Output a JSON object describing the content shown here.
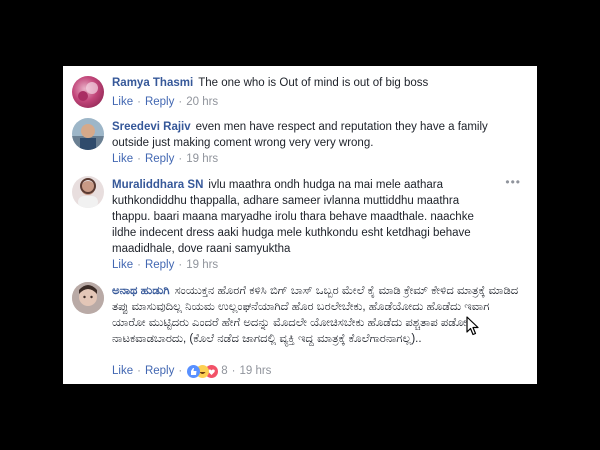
{
  "colors": {
    "name": "#365899",
    "link": "#4267b2",
    "meta": "#90949c",
    "text": "#1d2129"
  },
  "actions": {
    "like": "Like",
    "reply": "Reply",
    "sep": "·"
  },
  "comments": [
    {
      "name": "Ramya Thasmi",
      "text": "The one who is Out of mind is out of big boss",
      "time": "20 hrs"
    },
    {
      "name": "Sreedevi Rajiv",
      "text": "even men have respect and reputation they have a family outside just making coment wrong very very wrong.",
      "time": "19 hrs"
    },
    {
      "name": "Muraliddhara SN",
      "text": "ivlu maathra ondh hudga na mai mele aathara kuthkondiddhu thappalla, adhare sameer ivlanna muttiddhu maathra thappu. baari maana maryadhe irolu thara behave maadthale. naachke ildhe indecent dress aaki hudga mele kuthkondu esht ketdhagi behave maadidhale, dove raani samyuktha",
      "time": "19 hrs",
      "more": "•••"
    },
    {
      "name": "ಅನಾಥ ಹುಡುಗಿ",
      "text": "ಸಂಯುಕ್ತನ ಹೊರಗೆ ಕಳಿಸಿ ಬಿಗ್ ಬಾಸ್ ಒಬ್ಬರ ಮೇಲೆ ಕೈ ಮಾಡಿ ಕ್ರೇಮ್ ಕೇಳಿದ ಮಾತ್ರಕ್ಕೆ ಮಾಡಿದ ತಪ್ಪು ಮಾಸುವುದಿಲ್ಲ ನಿಯಮ ಉಲ್ಲಂಘನೆಯಾಗಿದೆ ಹೊರ ಬರಲೇಬೇಕು, ಹೊಡೆಯೋದು ಹೊಡೆದು ಇವಾಗ ಯಾರೋ ಮುಟ್ಟಿದರು ಎಂದರೆ ಹೇಗೆ ಅದನ್ನು ಮೊದಲೇ ಯೋಚಿಸಬೇಕು ಹೊಡೆದು ಪಶ್ಚತಾಪ ಪಡೋ ನಾಟಕವಾಡಬಾರದು, (ಕೊಲೆ ನಡೆದ ಜಾಗದಲ್ಲಿ ವ್ಯಕ್ತಿ ಇದ್ದ ಮಾತ್ರಕ್ಕೆ ಕೊಲೆಗಾರನಾಗಲ್ಲ)..",
      "time": "19 hrs",
      "reaction_count": "8",
      "reaction_icons": [
        "like-icon",
        "haha-icon",
        "love-icon"
      ]
    }
  ]
}
